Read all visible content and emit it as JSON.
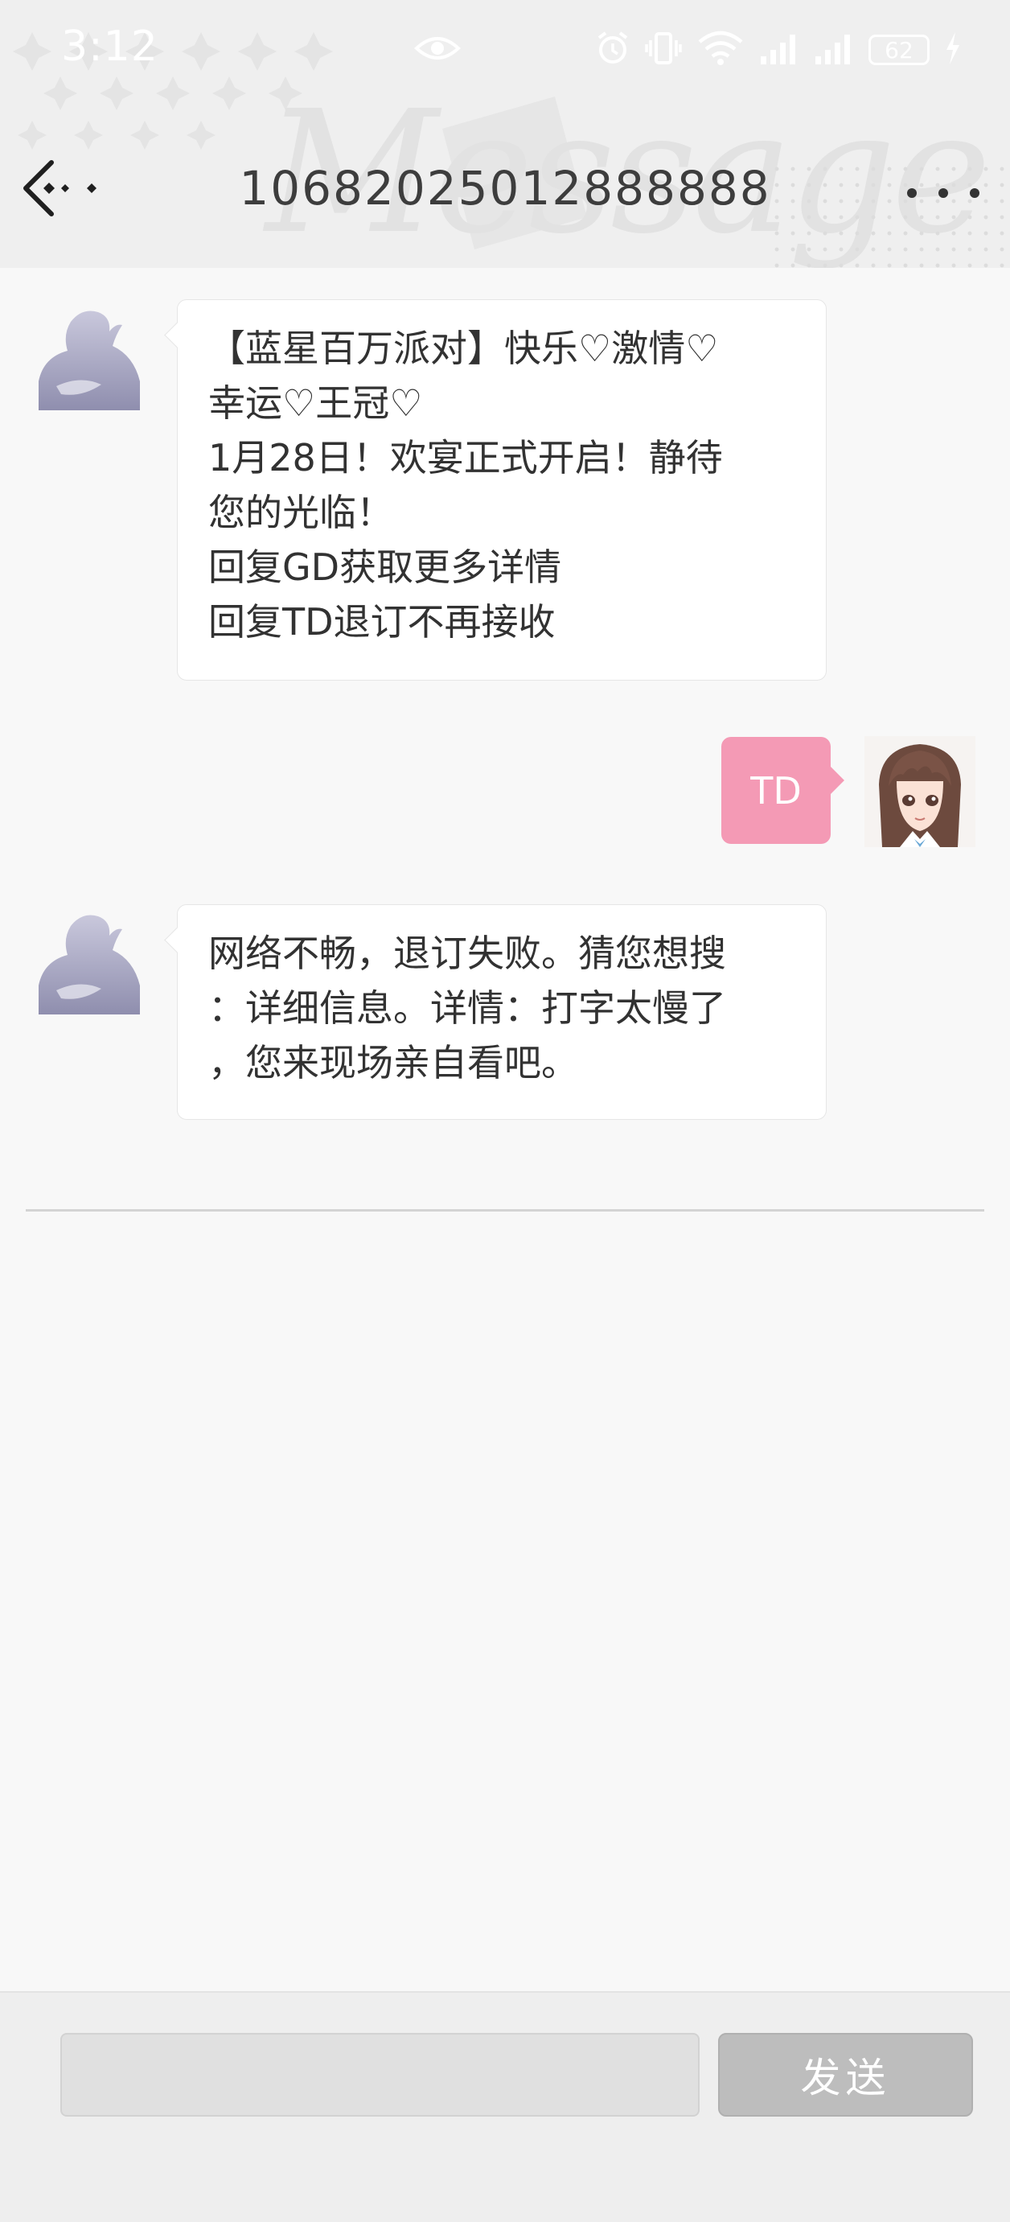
{
  "status_bar": {
    "time": "3:12",
    "battery_level": "62",
    "icons": [
      "eye-icon",
      "alarm-icon",
      "vibrate-icon",
      "wifi-icon",
      "signal-icon",
      "signal-icon",
      "battery-icon",
      "charging-icon"
    ]
  },
  "header": {
    "title": "10682025012888888",
    "watermark": "Message",
    "back_icon": "back-arrow-icon",
    "more_icon": "more-dots-icon"
  },
  "messages": [
    {
      "direction": "incoming",
      "lines": [
        "【蓝星百万派对】快乐♡激情♡",
        "幸运♡王冠♡",
        "1月28日！欢宴正式开启！静待",
        "您的光临！",
        "回复GD获取更多详情",
        "回复TD退订不再接收"
      ]
    },
    {
      "direction": "outgoing",
      "text": "TD"
    },
    {
      "direction": "incoming",
      "lines": [
        "网络不畅，退订失败。猜您想搜",
        "：详细信息。详情：打字太慢了",
        "，您来现场亲自看吧。"
      ]
    }
  ],
  "composer": {
    "input_value": "",
    "placeholder": "",
    "send_label": "发送"
  },
  "colors": {
    "outgoing_bubble": "#f49ab5",
    "incoming_bubble": "#ffffff",
    "send_button": "#bdbdbd"
  }
}
